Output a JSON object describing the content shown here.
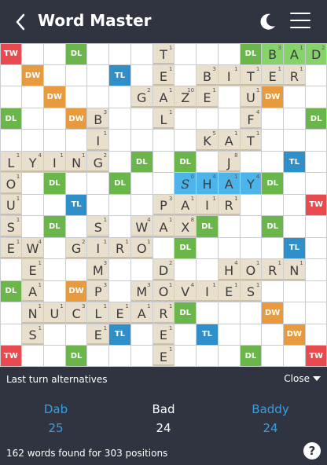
{
  "header": {
    "title": "Word Master",
    "back_icon": "back-arrow-icon",
    "theme_icon": "moon-icon",
    "menu_icon": "hamburger-menu-icon"
  },
  "colors": {
    "background": "#2f3440",
    "TW": "#e84a4f",
    "DW": "#e89a3e",
    "TL": "#2f8fc9",
    "DL": "#6bb64a",
    "tile": "#e9dfcd",
    "highlight_green": "#86d36a",
    "highlight_blue": "#4cb4e8",
    "link": "#3a9fe0"
  },
  "board": {
    "size": 15,
    "bonus_labels": {
      "TW": "TW",
      "DW": "DW",
      "TL": "TL",
      "DL": "DL"
    },
    "bonuses": [
      {
        "r": 0,
        "c": 0,
        "t": "TW"
      },
      {
        "r": 0,
        "c": 3,
        "t": "DL"
      },
      {
        "r": 0,
        "c": 11,
        "t": "DL"
      },
      {
        "r": 0,
        "c": 14,
        "t": "TW"
      },
      {
        "r": 1,
        "c": 1,
        "t": "DW"
      },
      {
        "r": 1,
        "c": 5,
        "t": "TL"
      },
      {
        "r": 2,
        "c": 2,
        "t": "DW"
      },
      {
        "r": 2,
        "c": 12,
        "t": "DW"
      },
      {
        "r": 3,
        "c": 0,
        "t": "DL"
      },
      {
        "r": 3,
        "c": 3,
        "t": "DW"
      },
      {
        "r": 3,
        "c": 14,
        "t": "DL"
      },
      {
        "r": 5,
        "c": 6,
        "t": "DL"
      },
      {
        "r": 5,
        "c": 8,
        "t": "DL"
      },
      {
        "r": 5,
        "c": 13,
        "t": "TL"
      },
      {
        "r": 6,
        "c": 2,
        "t": "DL"
      },
      {
        "r": 6,
        "c": 5,
        "t": "DL"
      },
      {
        "r": 6,
        "c": 12,
        "t": "DL"
      },
      {
        "r": 7,
        "c": 3,
        "t": "TL"
      },
      {
        "r": 7,
        "c": 14,
        "t": "TW"
      },
      {
        "r": 8,
        "c": 2,
        "t": "DL"
      },
      {
        "r": 8,
        "c": 9,
        "t": "DL"
      },
      {
        "r": 8,
        "c": 12,
        "t": "DL"
      },
      {
        "r": 9,
        "c": 8,
        "t": "DL"
      },
      {
        "r": 9,
        "c": 13,
        "t": "TL"
      },
      {
        "r": 11,
        "c": 0,
        "t": "DL"
      },
      {
        "r": 11,
        "c": 3,
        "t": "DW"
      },
      {
        "r": 12,
        "c": 8,
        "t": "DL"
      },
      {
        "r": 12,
        "c": 12,
        "t": "DW"
      },
      {
        "r": 13,
        "c": 5,
        "t": "TL"
      },
      {
        "r": 13,
        "c": 9,
        "t": "TL"
      },
      {
        "r": 13,
        "c": 13,
        "t": "DW"
      },
      {
        "r": 14,
        "c": 0,
        "t": "TW"
      },
      {
        "r": 14,
        "c": 3,
        "t": "DL"
      },
      {
        "r": 14,
        "c": 11,
        "t": "DL"
      },
      {
        "r": 14,
        "c": 14,
        "t": "TW"
      }
    ],
    "tiles": [
      {
        "r": 0,
        "c": 7,
        "l": "T",
        "s": "1"
      },
      {
        "r": 0,
        "c": 12,
        "l": "B",
        "s": "3",
        "hl": "green"
      },
      {
        "r": 0,
        "c": 13,
        "l": "A",
        "s": "1",
        "hl": "green"
      },
      {
        "r": 0,
        "c": 14,
        "l": "D",
        "s": "2",
        "hl": "green"
      },
      {
        "r": 1,
        "c": 7,
        "l": "E",
        "s": "1"
      },
      {
        "r": 1,
        "c": 9,
        "l": "B",
        "s": "3"
      },
      {
        "r": 1,
        "c": 10,
        "l": "I",
        "s": "1"
      },
      {
        "r": 1,
        "c": 11,
        "l": "T",
        "s": "1"
      },
      {
        "r": 1,
        "c": 12,
        "l": "E",
        "s": "1"
      },
      {
        "r": 1,
        "c": 13,
        "l": "R",
        "s": "1"
      },
      {
        "r": 2,
        "c": 6,
        "l": "G",
        "s": "2"
      },
      {
        "r": 2,
        "c": 7,
        "l": "A",
        "s": "1"
      },
      {
        "r": 2,
        "c": 8,
        "l": "Z",
        "s": "10"
      },
      {
        "r": 2,
        "c": 9,
        "l": "E",
        "s": "1"
      },
      {
        "r": 2,
        "c": 11,
        "l": "U",
        "s": "1"
      },
      {
        "r": 3,
        "c": 4,
        "l": "B",
        "s": "3"
      },
      {
        "r": 3,
        "c": 7,
        "l": "L",
        "s": "1"
      },
      {
        "r": 3,
        "c": 11,
        "l": "F",
        "s": "4"
      },
      {
        "r": 4,
        "c": 4,
        "l": "I",
        "s": "1"
      },
      {
        "r": 4,
        "c": 9,
        "l": "K",
        "s": "5"
      },
      {
        "r": 4,
        "c": 10,
        "l": "A",
        "s": "1"
      },
      {
        "r": 4,
        "c": 11,
        "l": "T",
        "s": "1"
      },
      {
        "r": 5,
        "c": 0,
        "l": "L",
        "s": "1"
      },
      {
        "r": 5,
        "c": 1,
        "l": "Y",
        "s": "4"
      },
      {
        "r": 5,
        "c": 2,
        "l": "I",
        "s": "1"
      },
      {
        "r": 5,
        "c": 3,
        "l": "N",
        "s": "1"
      },
      {
        "r": 5,
        "c": 4,
        "l": "G",
        "s": "2"
      },
      {
        "r": 5,
        "c": 10,
        "l": "J",
        "s": "8"
      },
      {
        "r": 6,
        "c": 0,
        "l": "O",
        "s": "1"
      },
      {
        "r": 6,
        "c": 8,
        "l": "S",
        "s": "0",
        "hl": "blue",
        "italic": true
      },
      {
        "r": 6,
        "c": 9,
        "l": "H",
        "s": "4",
        "hl": "blue"
      },
      {
        "r": 6,
        "c": 10,
        "l": "A",
        "s": "1",
        "hl": "blue"
      },
      {
        "r": 6,
        "c": 11,
        "l": "Y",
        "s": "4",
        "hl": "blue"
      },
      {
        "r": 7,
        "c": 0,
        "l": "U",
        "s": "1"
      },
      {
        "r": 7,
        "c": 7,
        "l": "P",
        "s": "3"
      },
      {
        "r": 7,
        "c": 8,
        "l": "A",
        "s": "1"
      },
      {
        "r": 7,
        "c": 9,
        "l": "I",
        "s": "1"
      },
      {
        "r": 7,
        "c": 10,
        "l": "R",
        "s": "1"
      },
      {
        "r": 8,
        "c": 0,
        "l": "S",
        "s": "1"
      },
      {
        "r": 8,
        "c": 4,
        "l": "S",
        "s": "1"
      },
      {
        "r": 8,
        "c": 6,
        "l": "W",
        "s": "4"
      },
      {
        "r": 8,
        "c": 7,
        "l": "A",
        "s": "1"
      },
      {
        "r": 8,
        "c": 8,
        "l": "X",
        "s": "8"
      },
      {
        "r": 9,
        "c": 0,
        "l": "E",
        "s": "1"
      },
      {
        "r": 9,
        "c": 1,
        "l": "W",
        "s": "4"
      },
      {
        "r": 9,
        "c": 3,
        "l": "G",
        "s": "2"
      },
      {
        "r": 9,
        "c": 4,
        "l": "I",
        "s": "1"
      },
      {
        "r": 9,
        "c": 5,
        "l": "R",
        "s": "1"
      },
      {
        "r": 9,
        "c": 6,
        "l": "O",
        "s": "1"
      },
      {
        "r": 10,
        "c": 1,
        "l": "E",
        "s": "1"
      },
      {
        "r": 10,
        "c": 4,
        "l": "M",
        "s": "3"
      },
      {
        "r": 10,
        "c": 7,
        "l": "D",
        "s": "2"
      },
      {
        "r": 10,
        "c": 10,
        "l": "H",
        "s": "4"
      },
      {
        "r": 10,
        "c": 11,
        "l": "O",
        "s": "1"
      },
      {
        "r": 10,
        "c": 12,
        "l": "R",
        "s": "1"
      },
      {
        "r": 10,
        "c": 13,
        "l": "N",
        "s": "1"
      },
      {
        "r": 11,
        "c": 1,
        "l": "A",
        "s": "1"
      },
      {
        "r": 11,
        "c": 4,
        "l": "P",
        "s": "3"
      },
      {
        "r": 11,
        "c": 6,
        "l": "M",
        "s": "3"
      },
      {
        "r": 11,
        "c": 7,
        "l": "O",
        "s": "1"
      },
      {
        "r": 11,
        "c": 8,
        "l": "V",
        "s": "4"
      },
      {
        "r": 11,
        "c": 9,
        "l": "I",
        "s": "1"
      },
      {
        "r": 11,
        "c": 10,
        "l": "E",
        "s": "1"
      },
      {
        "r": 11,
        "c": 11,
        "l": "S",
        "s": "1"
      },
      {
        "r": 12,
        "c": 1,
        "l": "N",
        "s": "1"
      },
      {
        "r": 12,
        "c": 2,
        "l": "U",
        "s": "1"
      },
      {
        "r": 12,
        "c": 3,
        "l": "C",
        "s": "3"
      },
      {
        "r": 12,
        "c": 4,
        "l": "L",
        "s": "1"
      },
      {
        "r": 12,
        "c": 5,
        "l": "E",
        "s": "1"
      },
      {
        "r": 12,
        "c": 6,
        "l": "A",
        "s": "1"
      },
      {
        "r": 12,
        "c": 7,
        "l": "R",
        "s": "1"
      },
      {
        "r": 13,
        "c": 1,
        "l": "S",
        "s": "1"
      },
      {
        "r": 13,
        "c": 4,
        "l": "E",
        "s": "1"
      },
      {
        "r": 13,
        "c": 7,
        "l": "E",
        "s": "1"
      },
      {
        "r": 14,
        "c": 7,
        "l": "E",
        "s": "1"
      }
    ]
  },
  "alternatives": {
    "title": "Last turn alternatives",
    "close_label": "Close",
    "items": [
      {
        "word": "Dab",
        "score": "25",
        "selected": false
      },
      {
        "word": "Bad",
        "score": "24",
        "selected": true
      },
      {
        "word": "Baddy",
        "score": "24",
        "selected": false
      }
    ]
  },
  "summary": "162 words found for 303 positions",
  "help_label": "?"
}
